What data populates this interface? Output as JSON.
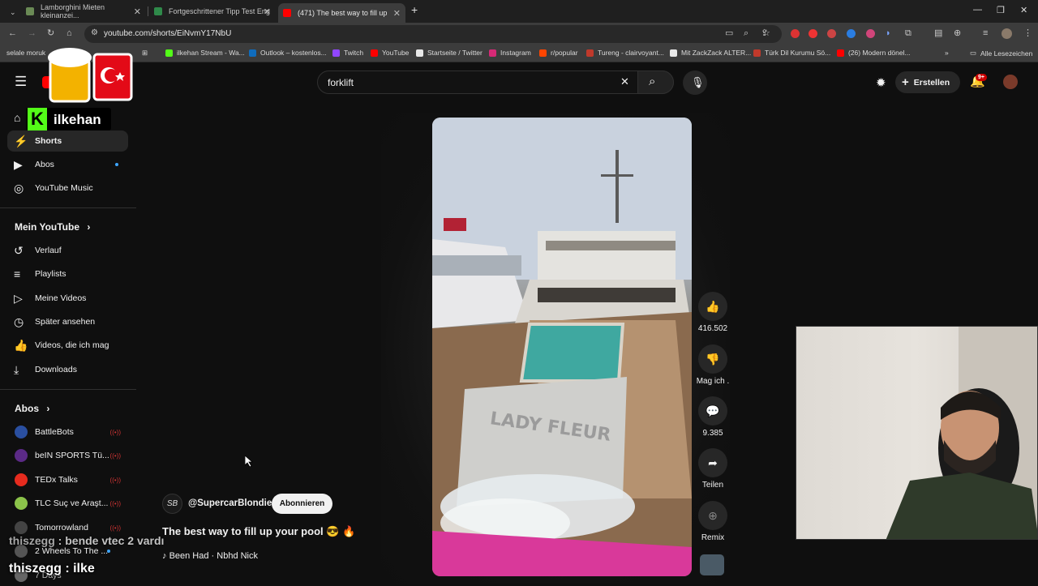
{
  "browser": {
    "tabs": [
      {
        "title": "Lamborghini Mieten kleinanzei...",
        "fav_color": "#6a8a55"
      },
      {
        "title": "Fortgeschrittener Tipp Test Eng",
        "fav_color": "#2f8a4a"
      },
      {
        "title": "(471) The best way to fill up",
        "fav_color": "#ff0000"
      }
    ],
    "url": "youtube.com/shorts/EiNvmY17NbU",
    "bookmarks": [
      {
        "label": "selale moruk",
        "color": "#888"
      },
      {
        "label": "ilkehan Stream - Wa...",
        "color": "#53fc18"
      },
      {
        "label": "Outlook – kostenlos...",
        "color": "#0f6cbd"
      },
      {
        "label": "Twitch",
        "color": "#9146ff"
      },
      {
        "label": "YouTube",
        "color": "#ff0000"
      },
      {
        "label": "Startseite / Twitter",
        "color": "#e8e8e8"
      },
      {
        "label": "Instagram",
        "color": "#d62976"
      },
      {
        "label": "r/popular",
        "color": "#ff4500"
      },
      {
        "label": "Tureng - clairvoyant...",
        "color": "#c0392b"
      },
      {
        "label": "Mit ZackZack ALTER...",
        "color": "#e8e8e8"
      },
      {
        "label": "Türk Dil Kurumu Sö...",
        "color": "#c0392b"
      },
      {
        "label": "(26) Modern dönel...",
        "color": "#ff0000"
      }
    ],
    "all_bookmarks": "Alle Lesezeichen"
  },
  "header": {
    "search_value": "forklift",
    "create_label": "Erstellen",
    "notifications": "9+"
  },
  "overlay": {
    "kick_name": "ilkehan"
  },
  "sidebar": {
    "items": [
      {
        "label": "Shorts",
        "icon": "shorts-icon"
      },
      {
        "label": "Abos",
        "icon": "subscriptions-icon"
      },
      {
        "label": "YouTube Music",
        "icon": "music-icon"
      }
    ],
    "mein_youtube": "Mein YouTube",
    "you_items": [
      {
        "label": "Verlauf"
      },
      {
        "label": "Playlists"
      },
      {
        "label": "Meine Videos"
      },
      {
        "label": "Später ansehen"
      },
      {
        "label": "Videos, die ich mag"
      },
      {
        "label": "Downloads"
      }
    ],
    "abos_head": "Abos",
    "channels": [
      {
        "label": "BattleBots",
        "color": "#2a4fa0"
      },
      {
        "label": "beIN SPORTS Tü...",
        "color": "#5b2a86"
      },
      {
        "label": "TEDx Talks",
        "color": "#e62b1e"
      },
      {
        "label": "TLC Suç ve Araşt...",
        "color": "#8bc34a"
      },
      {
        "label": "Tomorrowland",
        "color": "#444"
      },
      {
        "label": "2 Wheels To The ...",
        "color": "#555"
      },
      {
        "label": "7 Days",
        "color": "#666"
      }
    ]
  },
  "short": {
    "likes": "416.502",
    "dislike_label": "Mag ich .",
    "comments": "9.385",
    "share_label": "Teilen",
    "remix_label": "Remix",
    "channel_avatar": "SB",
    "channel": "@SupercarBlondie",
    "subscribe": "Abonnieren",
    "title": "The best way to fill up your pool 😎 🔥",
    "music": "Been Had · Nbhd Nick",
    "boat_name": "LADY FLEUR"
  },
  "chat": [
    {
      "user": "thiszegg",
      "msg": "bende vtec 2 vardı"
    },
    {
      "user": "thiszegg",
      "msg": "ilke"
    }
  ]
}
